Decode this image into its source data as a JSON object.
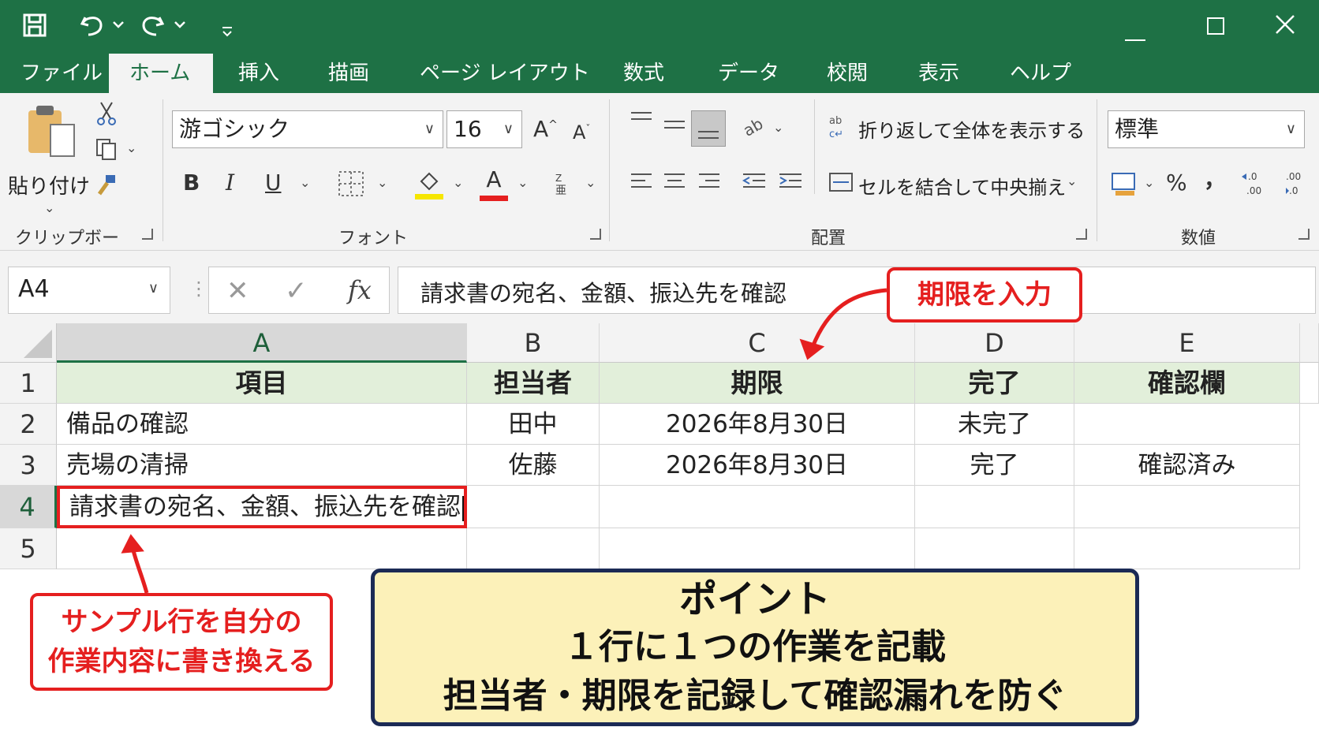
{
  "title_bar": {
    "icons": [
      "save-icon",
      "undo-icon",
      "redo-icon",
      "customize-icon",
      "minimize-icon",
      "maximize-icon",
      "close-icon"
    ]
  },
  "tabs": [
    "ファイル",
    "ホーム",
    "挿入",
    "描画",
    "ページ レイアウト",
    "数式",
    "データ",
    "校閲",
    "表示",
    "ヘルプ"
  ],
  "active_tab": "ホーム",
  "ribbon": {
    "clipboard": {
      "paste_label": "貼り付け",
      "group_label": "クリップボード"
    },
    "font": {
      "font_name": "游ゴシック",
      "font_size": "16",
      "group_label": "フォント",
      "bold": "B",
      "italic": "I",
      "underline": "U",
      "font_color_glyph": "A",
      "grow": "A",
      "shrink": "A",
      "highlight_color": "#f6e600",
      "font_color": "#e51f1f"
    },
    "alignment": {
      "wrap_text": "折り返して全体を表示する",
      "merge_center": "セルを結合して中央揃え",
      "group_label": "配置"
    },
    "number": {
      "format": "標準",
      "percent": "%",
      "comma": "，",
      "group_label": "数値"
    }
  },
  "formula_bar": {
    "name_box": "A4",
    "fx": "fx",
    "content": "請求書の宛名、金額、振込先を確認"
  },
  "sheet": {
    "columns": [
      "A",
      "B",
      "C",
      "D",
      "E"
    ],
    "rows": [
      "1",
      "2",
      "3",
      "4",
      "5"
    ],
    "selected_cell": "A4",
    "header": [
      "項目",
      "担当者",
      "期限",
      "完了",
      "確認欄"
    ],
    "data": [
      [
        "備品の確認",
        "田中",
        "2026年8月30日",
        "未完了",
        ""
      ],
      [
        "売場の清掃",
        "佐藤",
        "2026年8月30日",
        "完了",
        "確認済み"
      ],
      [
        "請求書の宛名、金額、振込先を確認",
        "",
        "",
        "",
        ""
      ],
      [
        "",
        "",
        "",
        "",
        ""
      ]
    ]
  },
  "annotations": {
    "deadline_callout": "期限を入力",
    "sample_callout_line1": "サンプル行を自分の",
    "sample_callout_line2": "作業内容に書き換える",
    "point_title": "ポイント",
    "point_line1": "１行に１つの作業を記載",
    "point_line2": "担当者・期限を記録して確認漏れを防ぐ",
    "accent_red": "#e51f1f",
    "point_bg": "#fcf1b9",
    "point_border": "#1b2a55"
  },
  "colors": {
    "excel_green": "#1e7145",
    "header_row_fill": "#e2efda"
  }
}
